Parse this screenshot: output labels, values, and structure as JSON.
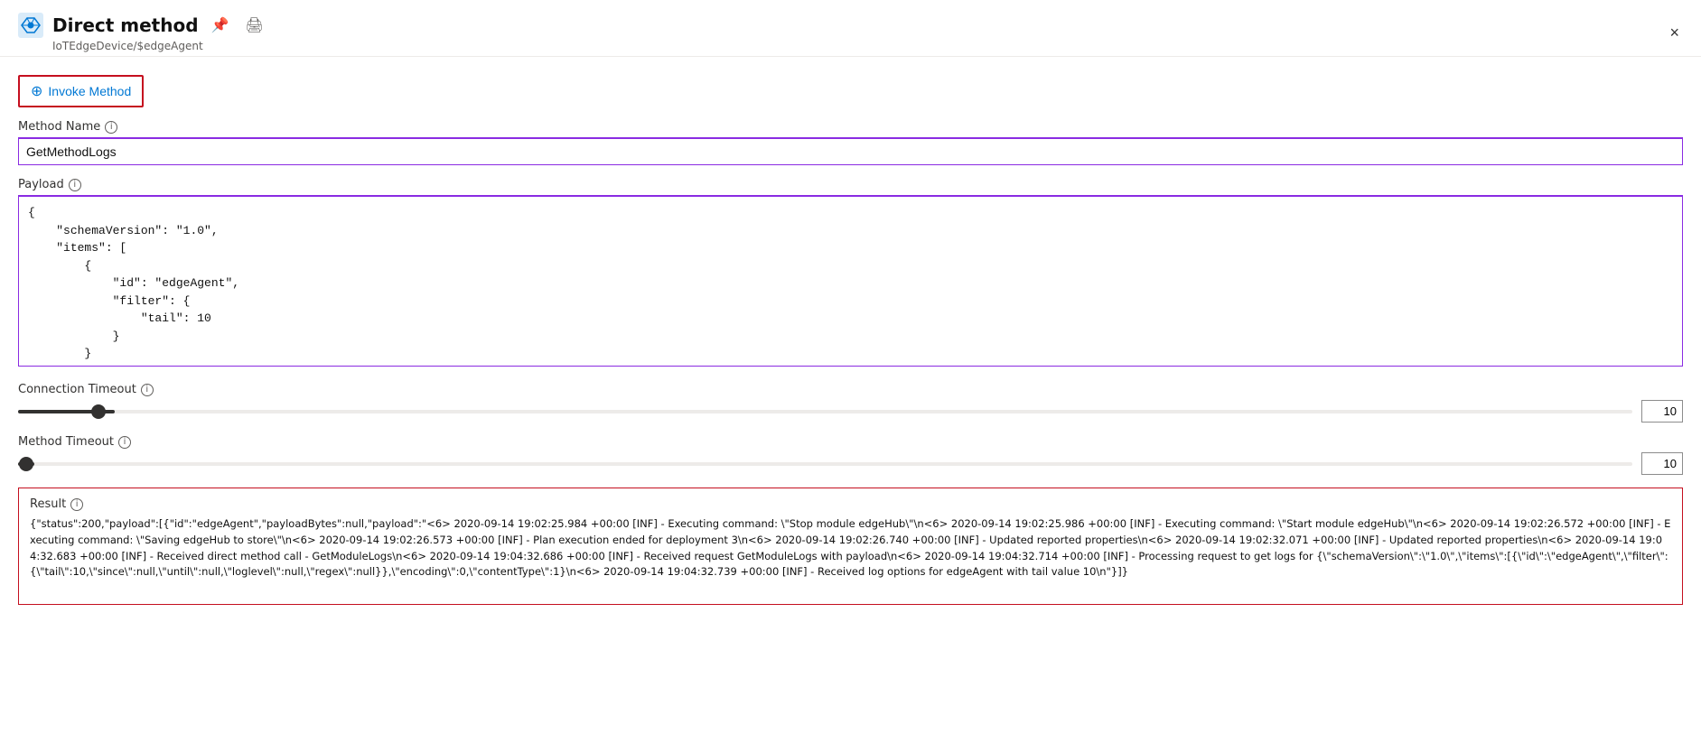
{
  "panel": {
    "title": "Direct method",
    "subtitle": "IoTEdgeDevice/$edgeAgent",
    "close_label": "×",
    "pin_icon": "pin-icon",
    "print_icon": "print-icon"
  },
  "invoke_method": {
    "button_label": "Invoke Method"
  },
  "method_name": {
    "label": "Method Name",
    "value": "GetMethodLogs"
  },
  "payload": {
    "label": "Payload",
    "value": "{\n    \"schemaVersion\": \"1.0\",\n    \"items\": [\n        {\n            \"id\": \"edgeAgent\",\n            \"filter\": {\n                \"tail\": 10\n            }\n        }\n    ],"
  },
  "connection_timeout": {
    "label": "Connection Timeout",
    "value": "10"
  },
  "method_timeout": {
    "label": "Method Timeout",
    "value": "10"
  },
  "result": {
    "label": "Result",
    "value": "{\"status\":200,\"payload\":[{\"id\":\"edgeAgent\",\"payloadBytes\":null,\"payload\":\"<6> 2020-09-14 19:02:25.984 +00:00 [INF] - Executing command: \\\"Stop module edgeHub\\\"\\n<6> 2020-09-14 19:02:25.986 +00:00 [INF] - Executing command: \\\"Start module edgeHub\\\"\\n<6> 2020-09-14 19:02:26.572 +00:00 [INF] - Executing command: \\\"Saving edgeHub to store\\\"\\n<6> 2020-09-14 19:02:26.573 +00:00 [INF] - Plan execution ended for deployment 3\\n<6> 2020-09-14 19:02:26.740 +00:00 [INF] - Updated reported properties\\n<6> 2020-09-14 19:02:32.071 +00:00 [INF] - Updated reported properties\\n<6> 2020-09-14 19:04:32.683 +00:00 [INF] - Received direct method call - GetModuleLogs\\n<6> 2020-09-14 19:04:32.686 +00:00 [INF] - Received request GetModuleLogs with payload\\n<6> 2020-09-14 19:04:32.714 +00:00 [INF] - Processing request to get logs for {\\\"schemaVersion\\\":\\\"1.0\\\",\\\"items\\\":[{\\\"id\\\":\\\"edgeAgent\\\",\\\"filter\\\":{\\\"tail\\\":10,\\\"since\\\":null,\\\"until\\\":null,\\\"loglevel\\\":null,\\\"regex\\\":null}},\\\"encoding\\\":0,\\\"contentType\\\":1}\\n<6> 2020-09-14 19:04:32.739 +00:00 [INF] - Received log options for edgeAgent with tail value 10\\n\"}]}"
  },
  "icons": {
    "info": "i",
    "invoke": "⊕",
    "pin": "📌",
    "print": "🖨",
    "close": "✕"
  }
}
